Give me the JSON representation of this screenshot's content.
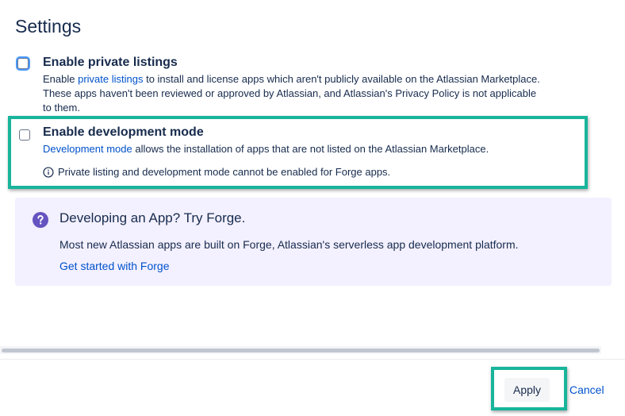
{
  "page": {
    "title": "Settings"
  },
  "options": {
    "private_listings": {
      "label": "Enable private listings",
      "desc_prefix": "Enable ",
      "desc_link": "private listings",
      "desc_line1_suffix": " to install and license apps which aren't publicly available on the Atlassian Marketplace.",
      "desc_line2": "These apps haven't been reviewed or approved by Atlassian, and Atlassian's Privacy Policy is not applicable",
      "desc_line3": "to them.",
      "checked": false
    },
    "development_mode": {
      "label": "Enable development mode",
      "desc_link": "Development mode",
      "desc_suffix": " allows the installation of apps that are not listed on the Atlassian Marketplace.",
      "note": "Private listing and development mode cannot be enabled for Forge apps.",
      "checked": false
    }
  },
  "forge_panel": {
    "title": "Developing an App? Try Forge.",
    "description": "Most new Atlassian apps are built on Forge, Atlassian's serverless app development platform.",
    "link": "Get started with Forge"
  },
  "footer": {
    "apply_label": "Apply",
    "cancel_label": "Cancel"
  },
  "colors": {
    "highlight": "#18B59B",
    "link": "#0052CC",
    "text": "#172B4D",
    "forge_bg": "#F3F0FF",
    "forge_icon": "#6554C0"
  },
  "icons": {
    "info": "info-icon",
    "forge": "question-circle-icon"
  }
}
